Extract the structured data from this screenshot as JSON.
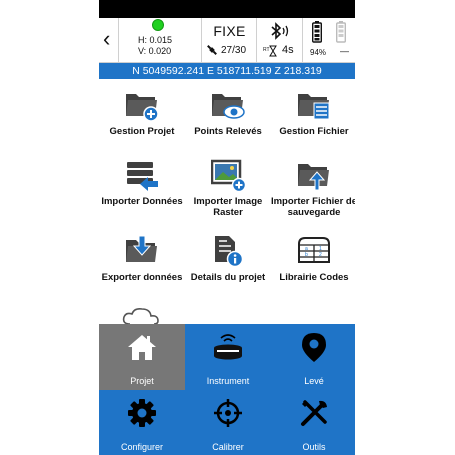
{
  "status": {
    "h_precision": "H: 0.015",
    "v_precision": "V: 0.020",
    "fix_status": "FIXE",
    "satellites": "27/30",
    "correction_age": "4s",
    "battery_percent": "94%",
    "battery2_percent": "—",
    "fix_dot_color": "#20d020"
  },
  "coordinates": "N 5049592.241 E 518711.519 Z 218.319",
  "grid": [
    {
      "label": "Gestion Projet",
      "icon": "folder-add-icon"
    },
    {
      "label": "Points Relevés",
      "icon": "folder-eye-icon"
    },
    {
      "label": "Gestion Fichier",
      "icon": "folder-list-icon"
    },
    {
      "label": "Importer Données",
      "icon": "import-data-icon"
    },
    {
      "label": "Importer Image Raster",
      "icon": "image-add-icon"
    },
    {
      "label": "Importer Fichier de sauvegarde",
      "icon": "folder-upload-icon"
    },
    {
      "label": "Exporter données",
      "icon": "folder-download-icon"
    },
    {
      "label": "Details du projet",
      "icon": "document-info-icon"
    },
    {
      "label": "Librairie Codes",
      "icon": "code-library-icon"
    }
  ],
  "nav": [
    {
      "label": "Projet",
      "icon": "home-icon",
      "active": true
    },
    {
      "label": "Instrument",
      "icon": "gnss-receiver-icon"
    },
    {
      "label": "Levé",
      "icon": "map-pin-icon"
    },
    {
      "label": "Configurer",
      "icon": "gear-icon"
    },
    {
      "label": "Calibrer",
      "icon": "crosshair-icon"
    },
    {
      "label": "Outils",
      "icon": "tools-icon"
    }
  ],
  "colors": {
    "accent": "#1f74c7",
    "active_tab": "#777777",
    "icon_dark": "#404040",
    "icon_blue": "#1f74c7"
  }
}
